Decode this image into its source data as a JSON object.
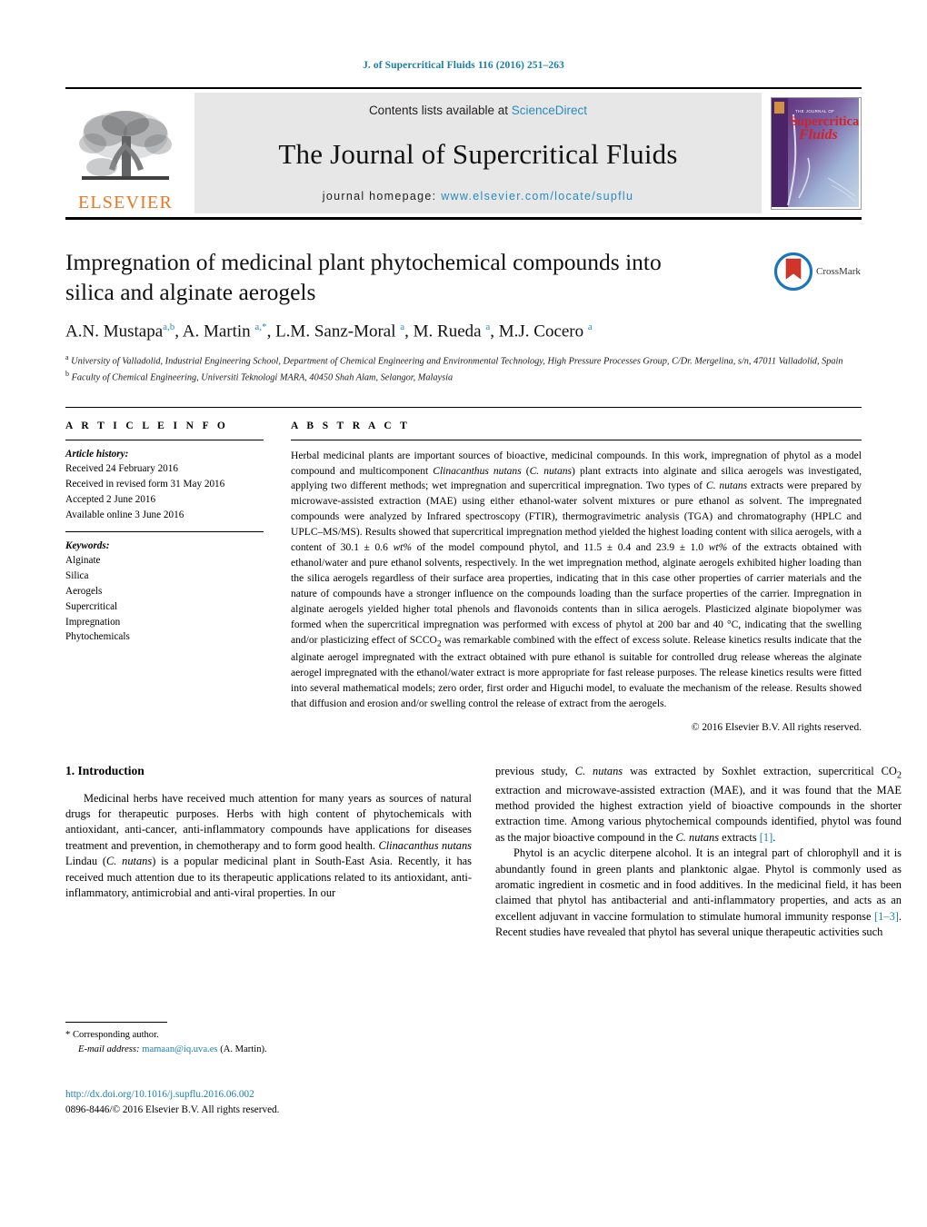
{
  "running_head": "J. of Supercritical Fluids 116 (2016) 251–263",
  "masthead": {
    "publisher_name": "ELSEVIER",
    "contents_prefix": "Contents lists available at ",
    "contents_link": "ScienceDirect",
    "journal_name": "The Journal of Supercritical Fluids",
    "homepage_prefix": "journal homepage: ",
    "homepage_url": "www.elsevier.com/locate/supflu",
    "cover_title_top": "THE JOURNAL OF",
    "cover_title_main": "Supercritical",
    "cover_title_sub": "Fluids"
  },
  "article": {
    "title": "Impregnation of medicinal plant phytochemical compounds into silica and alginate aerogels",
    "crossmark_label": "CrossMark",
    "authors_html": "A.N. Mustapa<sup>a,b</sup>, A. Martin <sup>a,*</sup>, L.M. Sanz-Moral <sup>a</sup>, M. Rueda <sup>a</sup>, M.J. Cocero <sup>a</sup>",
    "affiliations": [
      "a University of Valladolid, Industrial Engineering School, Department of Chemical Engineering and Environmental Technology, High Pressure Processes Group, C/Dr. Mergelina, s/n, 47011 Valladolid, Spain",
      "b Faculty of Chemical Engineering, Universiti Teknologi MARA, 40450 Shah Alam, Selangor, Malaysia"
    ],
    "affiliation_a_marker": "a",
    "affiliation_a_text": "University of Valladolid, Industrial Engineering School, Department of Chemical Engineering and Environmental Technology, High Pressure Processes Group, C/Dr. Mergelina, s/n, 47011 Valladolid, Spain",
    "affiliation_b_marker": "b",
    "affiliation_b_text": "Faculty of Chemical Engineering, Universiti Teknologi MARA, 40450 Shah Alam, Selangor, Malaysia"
  },
  "article_info": {
    "heading": "A R T I C L E   I N F O",
    "history_label": "Article history:",
    "history": [
      "Received 24 February 2016",
      "Received in revised form 31 May 2016",
      "Accepted 2 June 2016",
      "Available online 3 June 2016"
    ],
    "keywords_label": "Keywords:",
    "keywords": [
      "Alginate",
      "Silica",
      "Aerogels",
      "Supercritical",
      "Impregnation",
      "Phytochemicals"
    ]
  },
  "abstract": {
    "heading": "A B S T R A C T",
    "text": "Herbal medicinal plants are important sources of bioactive, medicinal compounds. In this work, impregnation of phytol as a model compound and multicomponent Clinacanthus nutans (C. nutans) plant extracts into alginate and silica aerogels was investigated, applying two different methods; wet impregnation and supercritical impregnation. Two types of C. nutans extracts were prepared by microwave-assisted extraction (MAE) using either ethanol-water solvent mixtures or pure ethanol as solvent. The impregnated compounds were analyzed by Infrared spectroscopy (FTIR), thermogravimetric analysis (TGA) and chromatography (HPLC and UPLC–MS/MS). Results showed that supercritical impregnation method yielded the highest loading content with silica aerogels, with a content of 30.1 ± 0.6 wt% of the model compound phytol, and 11.5 ± 0.4 and 23.9 ± 1.0 wt% of the extracts obtained with ethanol/water and pure ethanol solvents, respectively. In the wet impregnation method, alginate aerogels exhibited higher loading than the silica aerogels regardless of their surface area properties, indicating that in this case other properties of carrier materials and the nature of compounds have a stronger influence on the compounds loading than the surface properties of the carrier. Impregnation in alginate aerogels yielded higher total phenols and flavonoids contents than in silica aerogels. Plasticized alginate biopolymer was formed when the supercritical impregnation was performed with excess of phytol at 200 bar and 40 °C, indicating that the swelling and/or plasticizing effect of SCCO2 was remarkable combined with the effect of excess solute. Release kinetics results indicate that the alginate aerogel impregnated with the extract obtained with pure ethanol is suitable for controlled drug release whereas the alginate aerogel impregnated with the ethanol/water extract is more appropriate for fast release purposes. The release kinetics results were fitted into several mathematical models; zero order, first order and Higuchi model, to evaluate the mechanism of the release. Results showed that diffusion and erosion and/or swelling control the release of extract from the aerogels.",
    "copyright": "© 2016 Elsevier B.V. All rights reserved."
  },
  "introduction": {
    "heading": "1.  Introduction",
    "left_paragraph": "Medicinal herbs have received much attention for many years as sources of natural drugs for therapeutic purposes. Herbs with high content of phytochemicals with antioxidant, anti-cancer, anti-inflammatory compounds have applications for diseases treatment and prevention, in chemotherapy and to form good health. Clinacanthus nutans Lindau (C. nutans) is a popular medicinal plant in South-East Asia. Recently, it has received much attention due to its therapeutic applications related to its antioxidant, anti-inflammatory, antimicrobial and anti-viral properties. In our",
    "right_paragraph_1": "previous study, C. nutans was extracted by Soxhlet extraction, supercritical CO2 extraction and microwave-assisted extraction (MAE), and it was found that the MAE method provided the highest extraction yield of bioactive compounds in the shorter extraction time. Among various phytochemical compounds identified, phytol was found as the major bioactive compound in the C. nutans extracts [1].",
    "right_paragraph_2": "Phytol is an acyclic diterpene alcohol. It is an integral part of chlorophyll and it is abundantly found in green plants and planktonic algae. Phytol is commonly used as aromatic ingredient in cosmetic and in food additives. In the medicinal field, it has been claimed that phytol has antibacterial and anti-inflammatory properties, and acts as an excellent adjuvant in vaccine formulation to stimulate humoral immunity response [1–3]. Recent studies have revealed that phytol has several unique therapeutic activities such"
  },
  "footnote": {
    "corresponding_marker": "*",
    "corresponding_text": "Corresponding author.",
    "email_label": "E-mail address:",
    "email": "mamaan@iq.uva.es",
    "email_owner": "(A. Martin)."
  },
  "footer": {
    "doi": "http://dx.doi.org/10.1016/j.supflu.2016.06.002",
    "issn_copyright": "0896-8446/© 2016 Elsevier B.V. All rights reserved."
  },
  "colors": {
    "link": "#1a7fa8",
    "sciencedirect": "#2a8bbf",
    "elsevier_orange": "#E87722",
    "masthead_bg": "#e7e7e7"
  }
}
